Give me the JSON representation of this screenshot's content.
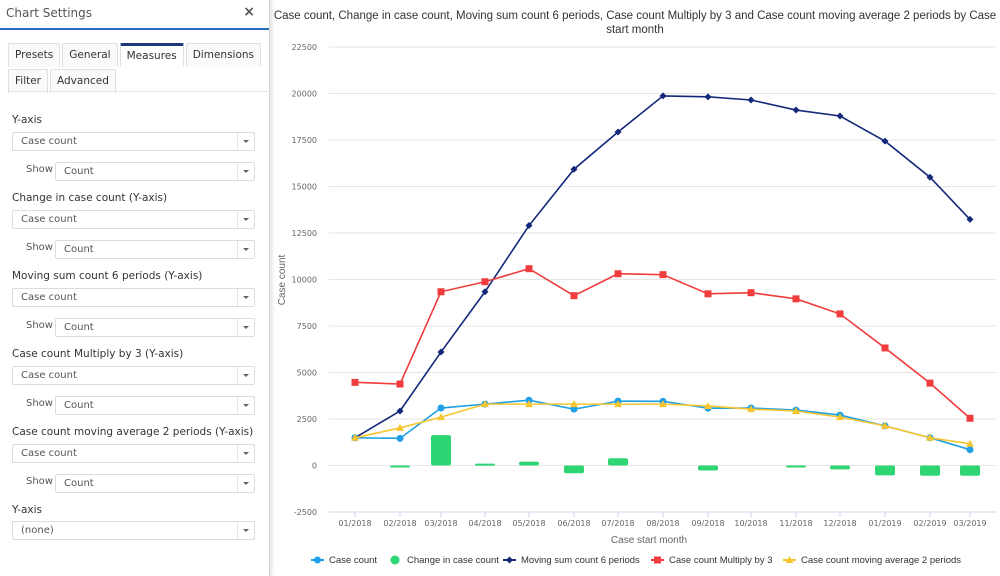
{
  "panel": {
    "title": "Chart Settings",
    "close_icon": "×",
    "tabs_row1": [
      {
        "label": "Presets",
        "active": false
      },
      {
        "label": "General",
        "active": false
      },
      {
        "label": "Measures",
        "active": true
      },
      {
        "label": "Dimensions",
        "active": false
      }
    ],
    "tabs_row2": [
      {
        "label": "Filter",
        "active": false
      },
      {
        "label": "Advanced",
        "active": false
      }
    ],
    "groups": [
      {
        "label": "Y-axis",
        "measure": "Case count",
        "show_label": "Show",
        "show": "Count"
      },
      {
        "label": "Change in case count (Y-axis)",
        "measure": "Case count",
        "show_label": "Show",
        "show": "Count"
      },
      {
        "label": "Moving sum count 6 periods (Y-axis)",
        "measure": "Case count",
        "show_label": "Show",
        "show": "Count"
      },
      {
        "label": "Case count Multiply by 3 (Y-axis)",
        "measure": "Case count",
        "show_label": "Show",
        "show": "Count"
      },
      {
        "label": "Case count moving average 2 periods (Y-axis)",
        "measure": "Case count",
        "show_label": "Show",
        "show": "Count"
      }
    ],
    "extra_axis": {
      "label": "Y-axis",
      "value": "(none)"
    }
  },
  "chart_data": {
    "type": "line",
    "title": "Case count, Change in case count, Moving sum count 6 periods, Case count Multiply by 3 and Case count moving average 2 periods by Case start month",
    "title_lines": [
      "Case count, Change in case count, Moving sum count 6 periods, Case count Multiply by 3 and Case count moving average 2 periods by Case",
      "start month"
    ],
    "xlabel": "Case start month",
    "ylabel": "Case count",
    "ylim": [
      -2500,
      22500
    ],
    "yticks": [
      -2500,
      0,
      2500,
      5000,
      7500,
      10000,
      12500,
      15000,
      17500,
      20000,
      22500
    ],
    "grid": true,
    "legend_position": "bottom",
    "categories": [
      "01/2018",
      "02/2018",
      "03/2018",
      "04/2018",
      "05/2018",
      "06/2018",
      "07/2018",
      "08/2018",
      "09/2018",
      "10/2018",
      "11/2018",
      "12/2018",
      "01/2019",
      "02/2019",
      "03/2019"
    ],
    "series": [
      {
        "name": "Case count",
        "type": "line",
        "color": "#1ea0e6",
        "marker": "circle",
        "values": [
          1490,
          1460,
          3090,
          3300,
          3510,
          3030,
          3460,
          3450,
          3080,
          3090,
          2980,
          2710,
          2130,
          1490,
          850
        ]
      },
      {
        "name": "Change in case count",
        "type": "bar",
        "color": "#2ed573",
        "marker": "circle",
        "values": [
          null,
          -30,
          1630,
          100,
          210,
          -420,
          390,
          -10,
          -270,
          10,
          -50,
          -210,
          -530,
          -550,
          -550
        ]
      },
      {
        "name": "Moving sum count 6 periods",
        "type": "line",
        "color": "#14287a",
        "marker": "diamond",
        "values": [
          1490,
          2930,
          6100,
          9340,
          12900,
          15930,
          17930,
          19870,
          19820,
          19650,
          19110,
          18790,
          17440,
          15500,
          13230
        ]
      },
      {
        "name": "Case count Multiply by 3",
        "type": "line",
        "color": "#f03c3c",
        "marker": "square",
        "values": [
          4470,
          4380,
          9340,
          9880,
          10580,
          9130,
          10310,
          10260,
          9230,
          9290,
          8960,
          8150,
          6320,
          4430,
          2540
        ]
      },
      {
        "name": "Case count moving average 2 periods",
        "type": "line",
        "color": "#f7c62f",
        "marker": "triangle",
        "values": [
          1490,
          2020,
          2600,
          3300,
          3300,
          3300,
          3300,
          3300,
          3200,
          3030,
          2930,
          2600,
          2130,
          1490,
          1170
        ]
      }
    ]
  }
}
